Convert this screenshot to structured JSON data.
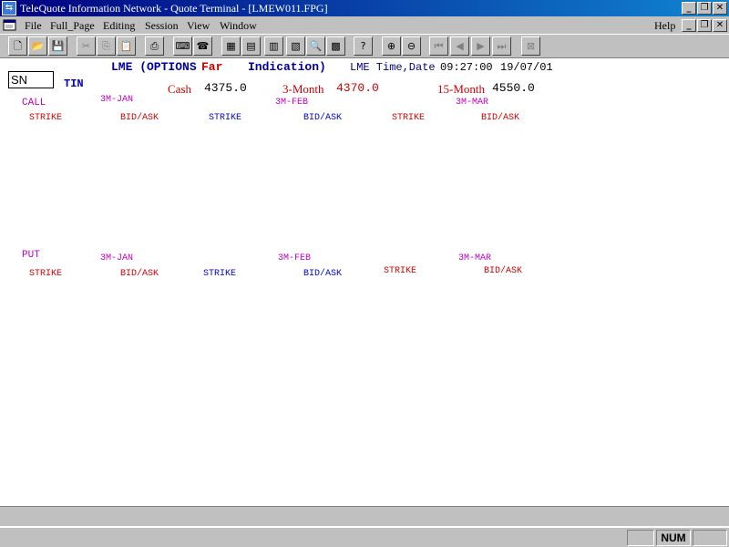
{
  "window": {
    "title": "TeleQuote Information Network - Quote Terminal - [LMEW011.FPG]",
    "menu_help": "Help"
  },
  "menu": [
    "File",
    "Full_Page",
    "Editing",
    "Session",
    "View",
    "Window"
  ],
  "toolbar_icons": [
    "new-icon",
    "open-icon",
    "save-icon",
    "cut-icon",
    "copy-icon",
    "paste-icon",
    "print-icon",
    "keyboard-icon",
    "phone-icon",
    "grid-icon",
    "calc-icon",
    "chart-icon",
    "live-icon",
    "search-doc-icon",
    "table-icon",
    "help-icon",
    "zoom-in-icon",
    "zoom-out-icon",
    "first-icon",
    "prev-icon",
    "next-icon",
    "last-icon",
    "close-page-icon"
  ],
  "header": {
    "symbol_input": "SN",
    "metal": "TIN",
    "title": "LME (OPTIONS",
    "title_far": "Far",
    "title_indication": "Indication)",
    "time_label": "LME Time,Date",
    "time": "09:27:00",
    "date": "19/07/01"
  },
  "prices": {
    "cash_label": "Cash",
    "cash_value": "4375.0",
    "three_month_label": "3-Month",
    "three_month_value": "4370.0",
    "fifteen_month_label": "15-Month",
    "fifteen_month_value": "4550.0"
  },
  "call": {
    "label": "CALL",
    "months": [
      "3M-JAN",
      "3M-FEB",
      "3M-MAR"
    ],
    "strike": "STRIKE",
    "bidask": "BID/ASK"
  },
  "put": {
    "label": "PUT",
    "months": [
      "3M-JAN",
      "3M-FEB",
      "3M-MAR"
    ],
    "strike": "STRIKE",
    "bidask": "BID/ASK"
  },
  "status": {
    "num": "NUM"
  },
  "colors": {
    "magenta": "#c000c0",
    "red": "#cc0000",
    "blue": "#0000cc",
    "title_blue": "#0000a0"
  }
}
